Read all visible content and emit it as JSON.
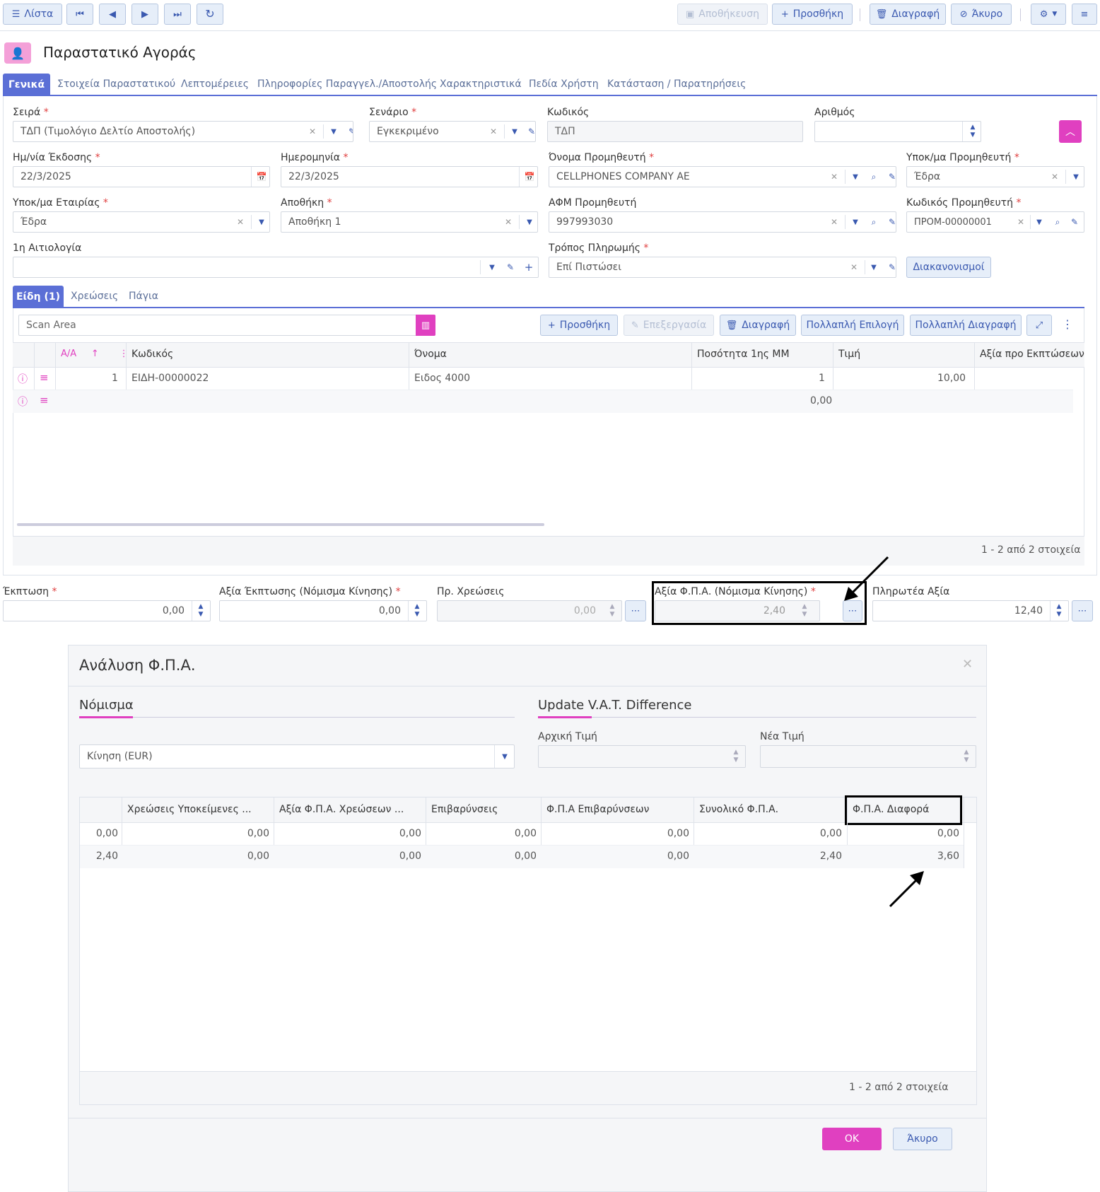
{
  "toolbar": {
    "list_label": "Λίστα",
    "save_label": "Αποθήκευση",
    "add_label": "Προσθήκη",
    "delete_label": "Διαγραφή",
    "cancel_label": "Άκυρο"
  },
  "page": {
    "title": "Παραστατικό Αγοράς"
  },
  "tabs": [
    "Γενικά",
    "Στοιχεία Παραστατικού",
    "Λεπτομέρειες",
    "Πληροφορίες Παραγγελ./Αποστολής",
    "Χαρακτηριστικά",
    "Πεδία Χρήστη",
    "Κατάσταση / Παρατηρήσεις"
  ],
  "form": {
    "series": {
      "label": "Σειρά",
      "value": "ΤΔΠ (Τιμολόγιο Δελτίο Αποστολής)"
    },
    "scenario": {
      "label": "Σενάριο",
      "value": "Εγκεκριμένο"
    },
    "code": {
      "label": "Κωδικός",
      "value": "ΤΔΠ"
    },
    "number": {
      "label": "Αριθμός",
      "value": ""
    },
    "issue_date": {
      "label": "Ημ/νία Έκδοσης",
      "value": "22/3/2025"
    },
    "date": {
      "label": "Ημερομηνία",
      "value": "22/3/2025"
    },
    "supplier_name": {
      "label": "Όνομα Προμηθευτή",
      "value": "CELLPHONES COMPANY AE"
    },
    "supplier_branch": {
      "label": "Υποκ/μα Προμηθευτή",
      "value": "Έδρα"
    },
    "company_branch": {
      "label": "Υποκ/μα Εταιρίας",
      "value": "Έδρα"
    },
    "warehouse": {
      "label": "Αποθήκη",
      "value": "Αποθήκη 1"
    },
    "supplier_vat": {
      "label": "ΑΦΜ Προμηθευτή",
      "value": "997993030"
    },
    "supplier_code": {
      "label": "Κωδικός Προμηθευτή",
      "value": "ΠΡΟΜ-00000001"
    },
    "reason": {
      "label": "1η Αιτιολογία",
      "value": ""
    },
    "payment": {
      "label": "Τρόπος Πληρωμής",
      "value": "Επί Πιστώσει"
    },
    "settlements_label": "Διακανονισμοί"
  },
  "subtabs": [
    "Είδη (1)",
    "Χρεώσεις",
    "Πάγια"
  ],
  "items": {
    "scan_placeholder": "Scan Area",
    "buttons": {
      "add": "Προσθήκη",
      "edit": "Επεξεργασία",
      "delete": "Διαγραφή",
      "multi_select": "Πολλαπλή Επιλογή",
      "multi_delete": "Πολλαπλή Διαγραφή"
    },
    "columns": [
      "Α/Α",
      "Κωδικός",
      "Όνομα",
      "Ποσότητα 1ης ΜΜ",
      "Τιμή",
      "Αξία προ Εκπτώσεων"
    ],
    "rows": [
      {
        "aa": "1",
        "code": "ΕΙΔΗ-00000022",
        "name": "Ειδος 4000",
        "qty": "1",
        "price": "10,00",
        "value": ""
      },
      {
        "aa": "",
        "code": "",
        "name": "",
        "qty": "0,00",
        "price": "",
        "value": ""
      }
    ],
    "pager": "1 - 2 από 2 στοιχεία"
  },
  "totals": {
    "discount": {
      "label": "Έκπτωση",
      "value": "0,00"
    },
    "discount_value": {
      "label": "Αξία Έκπτωσης (Νόμισμα Κίνησης)",
      "value": "0,00"
    },
    "charges": {
      "label": "Πρ. Χρεώσεις",
      "value": "0,00"
    },
    "vat_value": {
      "label": "Αξία Φ.Π.Α. (Νόμισμα Κίνησης)",
      "value": "2,40"
    },
    "payable": {
      "label": "Πληρωτέα Αξία",
      "value": "12,40"
    }
  },
  "dialog": {
    "title": "Ανάλυση Φ.Π.Α.",
    "currency_section": "Νόμισμα",
    "currency_value": "Κίνηση (EUR)",
    "update_section": "Update V.A.T. Difference",
    "initial_label": "Αρχική Τιμή",
    "new_label": "Νέα Τιμή",
    "columns": [
      "",
      "Χρεώσεις Υποκείμενες ...",
      "Αξία Φ.Π.Α. Χρεώσεων ...",
      "Επιβαρύνσεις",
      "Φ.Π.Α Επιβαρύνσεων",
      "Συνολικό Φ.Π.Α.",
      "Φ.Π.Α. Διαφορά"
    ],
    "rows": [
      [
        "0,00",
        "0,00",
        "0,00",
        "0,00",
        "0,00",
        "0,00",
        "0,00"
      ],
      [
        "2,40",
        "0,00",
        "0,00",
        "0,00",
        "0,00",
        "2,40",
        "3,60"
      ]
    ],
    "pager": "1 - 2 από 2 στοιχεία",
    "ok_label": "OK",
    "cancel_label": "Άκυρο"
  },
  "colors": {
    "accent": "#3a59b0",
    "brand_pink": "#e040c0",
    "active_tab": "#5b6fd6"
  }
}
